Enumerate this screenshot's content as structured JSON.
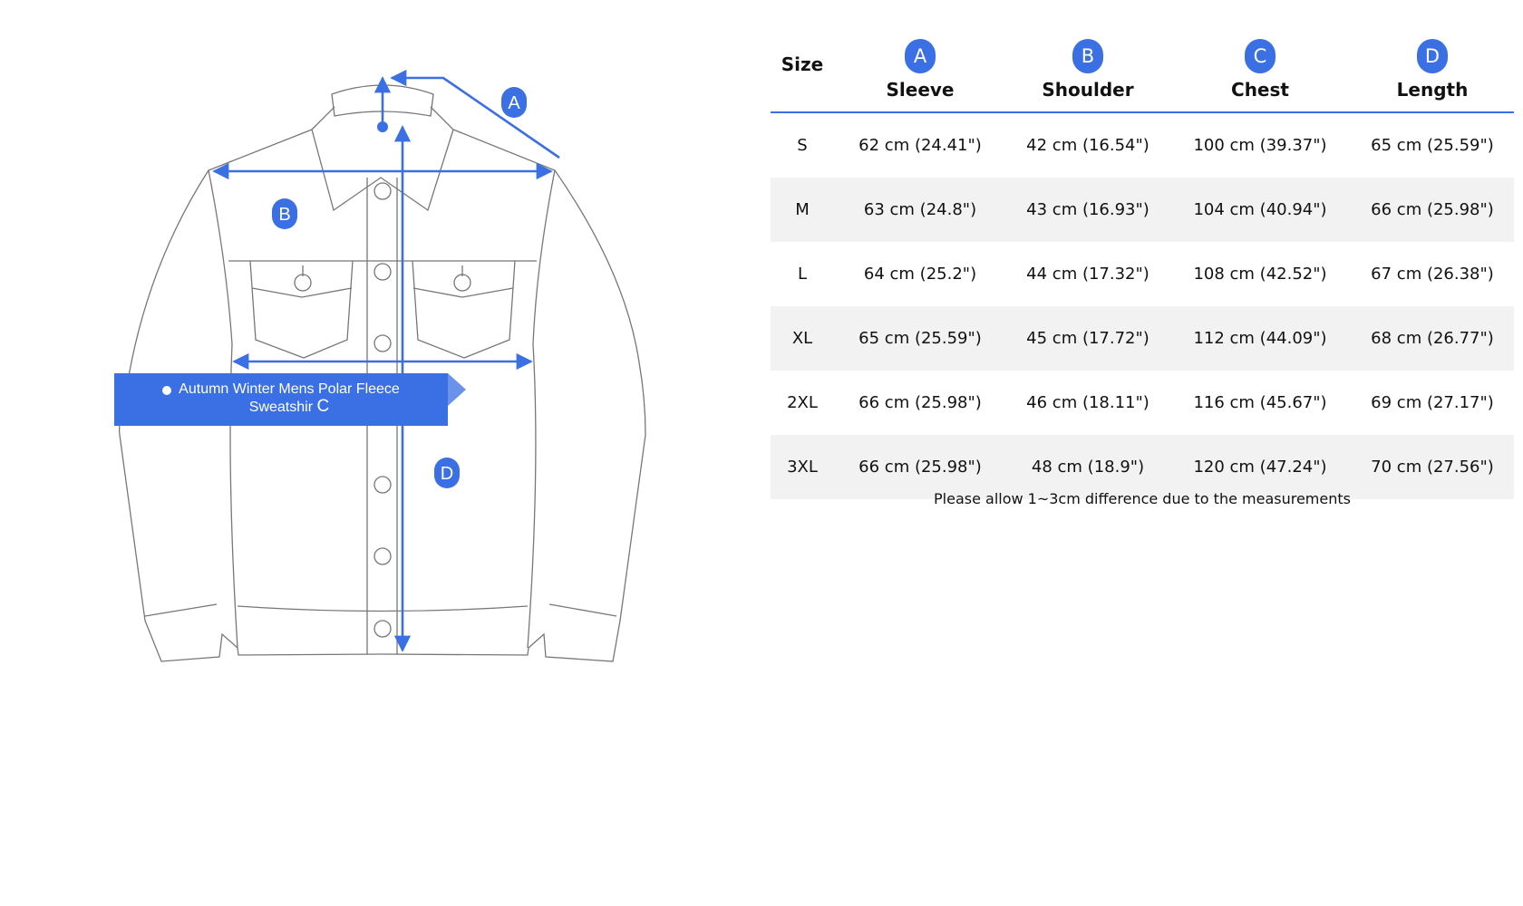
{
  "diagram": {
    "labels": {
      "a": "A",
      "b": "B",
      "c": "C",
      "d": "D"
    },
    "banner": {
      "line1": "Autumn Winter Mens Polar Fleece",
      "line2": "Sweatshir"
    },
    "colors": {
      "accent": "#3b6fe4",
      "outline": "#777777"
    }
  },
  "table": {
    "size_header": "Size",
    "columns": [
      {
        "badge": "A",
        "label": "Sleeve"
      },
      {
        "badge": "B",
        "label": "Shoulder"
      },
      {
        "badge": "C",
        "label": "Chest"
      },
      {
        "badge": "D",
        "label": "Length"
      }
    ],
    "rows": [
      {
        "size": "S",
        "sleeve": "62 cm (24.41\")",
        "shoulder": "42 cm (16.54\")",
        "chest": "100 cm (39.37\")",
        "length": "65 cm (25.59\")"
      },
      {
        "size": "M",
        "sleeve": "63 cm (24.8\")",
        "shoulder": "43 cm (16.93\")",
        "chest": "104 cm (40.94\")",
        "length": "66 cm (25.98\")"
      },
      {
        "size": "L",
        "sleeve": "64 cm (25.2\")",
        "shoulder": "44 cm (17.32\")",
        "chest": "108 cm (42.52\")",
        "length": "67 cm (26.38\")"
      },
      {
        "size": "XL",
        "sleeve": "65 cm (25.59\")",
        "shoulder": "45 cm (17.72\")",
        "chest": "112 cm (44.09\")",
        "length": "68 cm (26.77\")"
      },
      {
        "size": "2XL",
        "sleeve": "66 cm (25.98\")",
        "shoulder": "46 cm (18.11\")",
        "chest": "116 cm (45.67\")",
        "length": "69 cm (27.17\")"
      },
      {
        "size": "3XL",
        "sleeve": "66 cm (25.98\")",
        "shoulder": "48 cm (18.9\")",
        "chest": "120 cm (47.24\")",
        "length": "70 cm (27.56\")"
      }
    ],
    "note": "Please allow 1~3cm difference due to the measurements"
  }
}
